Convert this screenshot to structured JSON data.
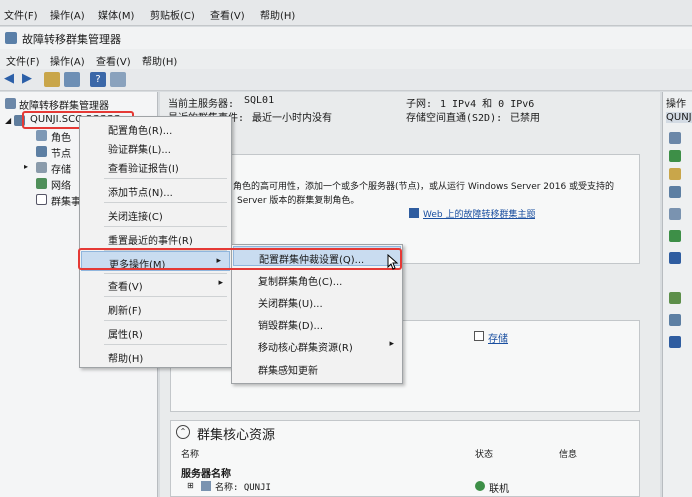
{
  "vm_menubar": {
    "items": [
      "文件(F)",
      "操作(A)",
      "媒体(M)",
      "剪贴板(C)",
      "查看(V)",
      "帮助(H)"
    ]
  },
  "app": {
    "title": "故障转移群集管理器",
    "menu": [
      "文件(F)",
      "操作(A)",
      "查看(V)",
      "帮助(H)"
    ]
  },
  "tree": {
    "root": "故障转移群集管理器",
    "cluster": "QUNJI.SCC-SCCCC.CCC",
    "children": [
      "角色",
      "节点",
      "存储",
      "网络",
      "群集事"
    ]
  },
  "summary": {
    "current_host_label": "当前主服务器:",
    "current_host_value": "SQL01",
    "recent_events_label": "最近的群集事件:",
    "recent_events_value": "最近一小时内没有",
    "network_label": "子网:",
    "network_value": "1 IPv4 和 0 IPv6",
    "s2d_label": "存储空间直通(S2D):",
    "s2d_value": "已禁用"
  },
  "description": {
    "line1": "角色的高可用性，添加一个或多个服务器(节点)，或从运行 Windows Server 2016 或受支持的",
    "line2": "Server 版本的群集复制角色。",
    "link": "Web 上的故障转移群集主题"
  },
  "nav_links": {
    "roles": "角色",
    "network": "网络",
    "storage": "存储"
  },
  "core_resources": {
    "header": "群集核心资源",
    "col_name": "名称",
    "col_status": "状态",
    "col_info": "信息",
    "group": "服务器名称",
    "row_name": "名称: QUNJI",
    "row_status": "联机"
  },
  "context_menu": {
    "items": [
      {
        "label": "配置角色(R)..."
      },
      {
        "label": "验证群集(L)..."
      },
      {
        "label": "查看验证报告(I)"
      },
      {
        "label": "添加节点(N)..."
      },
      {
        "label": "关闭连接(C)"
      },
      {
        "label": "重置最近的事件(R)"
      },
      {
        "label": "更多操作(M)",
        "has_submenu": true
      },
      {
        "label": "查看(V)",
        "has_submenu": true
      },
      {
        "label": "刷新(F)"
      },
      {
        "label": "属性(R)"
      },
      {
        "label": "帮助(H)"
      }
    ]
  },
  "submenu": {
    "items": [
      {
        "label": "配置群集仲裁设置(Q)..."
      },
      {
        "label": "复制群集角色(C)..."
      },
      {
        "label": "关闭群集(U)..."
      },
      {
        "label": "销毁群集(D)..."
      },
      {
        "label": "移动核心群集资源(R)",
        "has_submenu": true
      },
      {
        "label": "群集感知更新"
      }
    ]
  },
  "actions_panel": {
    "header": "操作",
    "cluster": "QUNJ"
  },
  "colors": {
    "highlight": "#c9dcf0",
    "annotation_red": "#e53935",
    "link_blue": "#1a4fa0"
  }
}
